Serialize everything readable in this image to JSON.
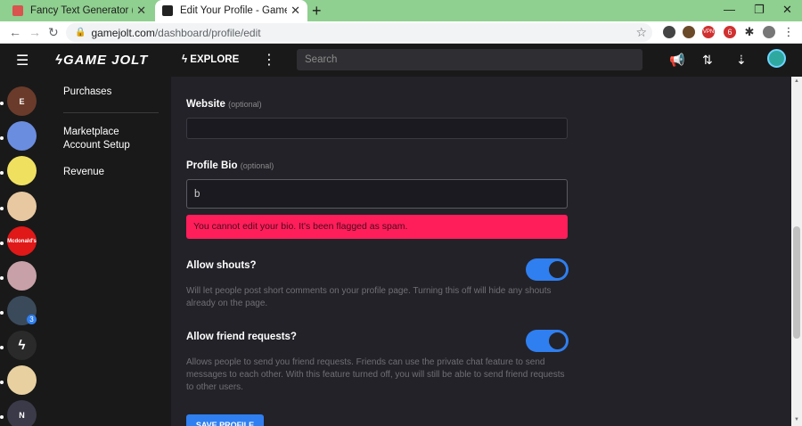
{
  "browser": {
    "tabs": [
      {
        "title": "Fancy Text Generator (𝓬𝓸𝓹𝔂 𝓪𝓷𝓭",
        "active": false
      },
      {
        "title": "Edit Your Profile - Game Jolt",
        "active": true
      }
    ],
    "new_tab": "+",
    "url_domain": "gamejolt.com",
    "url_path": "/dashboard/profile/edit",
    "ext_badge": "6"
  },
  "site": {
    "logo": "GAME JOLT",
    "explore": "EXPLORE",
    "search_placeholder": "Search"
  },
  "dashnav": {
    "items": [
      "Purchases",
      "Marketplace\nAccount Setup",
      "Revenue"
    ]
  },
  "form": {
    "website": {
      "label": "Website",
      "optional": "(optional)",
      "value": ""
    },
    "bio": {
      "label": "Profile Bio",
      "optional": "(optional)",
      "value": "b"
    },
    "bio_error": "You cannot edit your bio. It's been flagged as spam.",
    "shouts": {
      "label": "Allow shouts?",
      "help": "Will let people post short comments on your profile page. Turning this off will hide any shouts already on the page.",
      "enabled": true
    },
    "friend_requests": {
      "label": "Allow friend requests?",
      "help": "Allows people to send you friend requests. Friends can use the private chat feature to send messages to each other. With this feature turned off, you will still be able to send friend requests to other users.",
      "enabled": true
    },
    "save": "SAVE PROFILE"
  },
  "sidebar": {
    "avatars": [
      {
        "label": "E",
        "color": "#6a3b2a"
      },
      {
        "label": "",
        "color": "#6b8de0"
      },
      {
        "label": "",
        "color": "#f0e060"
      },
      {
        "label": "",
        "color": "#e8c8a0"
      },
      {
        "label": "Mcdonald's",
        "color": "#e01818"
      },
      {
        "label": "",
        "color": "#c8a0a8"
      },
      {
        "label": "",
        "color": "#3a4a5a"
      },
      {
        "label": "",
        "color": "#2a2a2a"
      },
      {
        "label": "",
        "color": "#e8d0a0"
      },
      {
        "label": "N",
        "color": "#3a3a48"
      }
    ],
    "badge": "3"
  },
  "colors": {
    "accent_blue": "#2f7ff0",
    "error_red": "#ff1e5a",
    "tab_green": "#8fcf8f"
  }
}
